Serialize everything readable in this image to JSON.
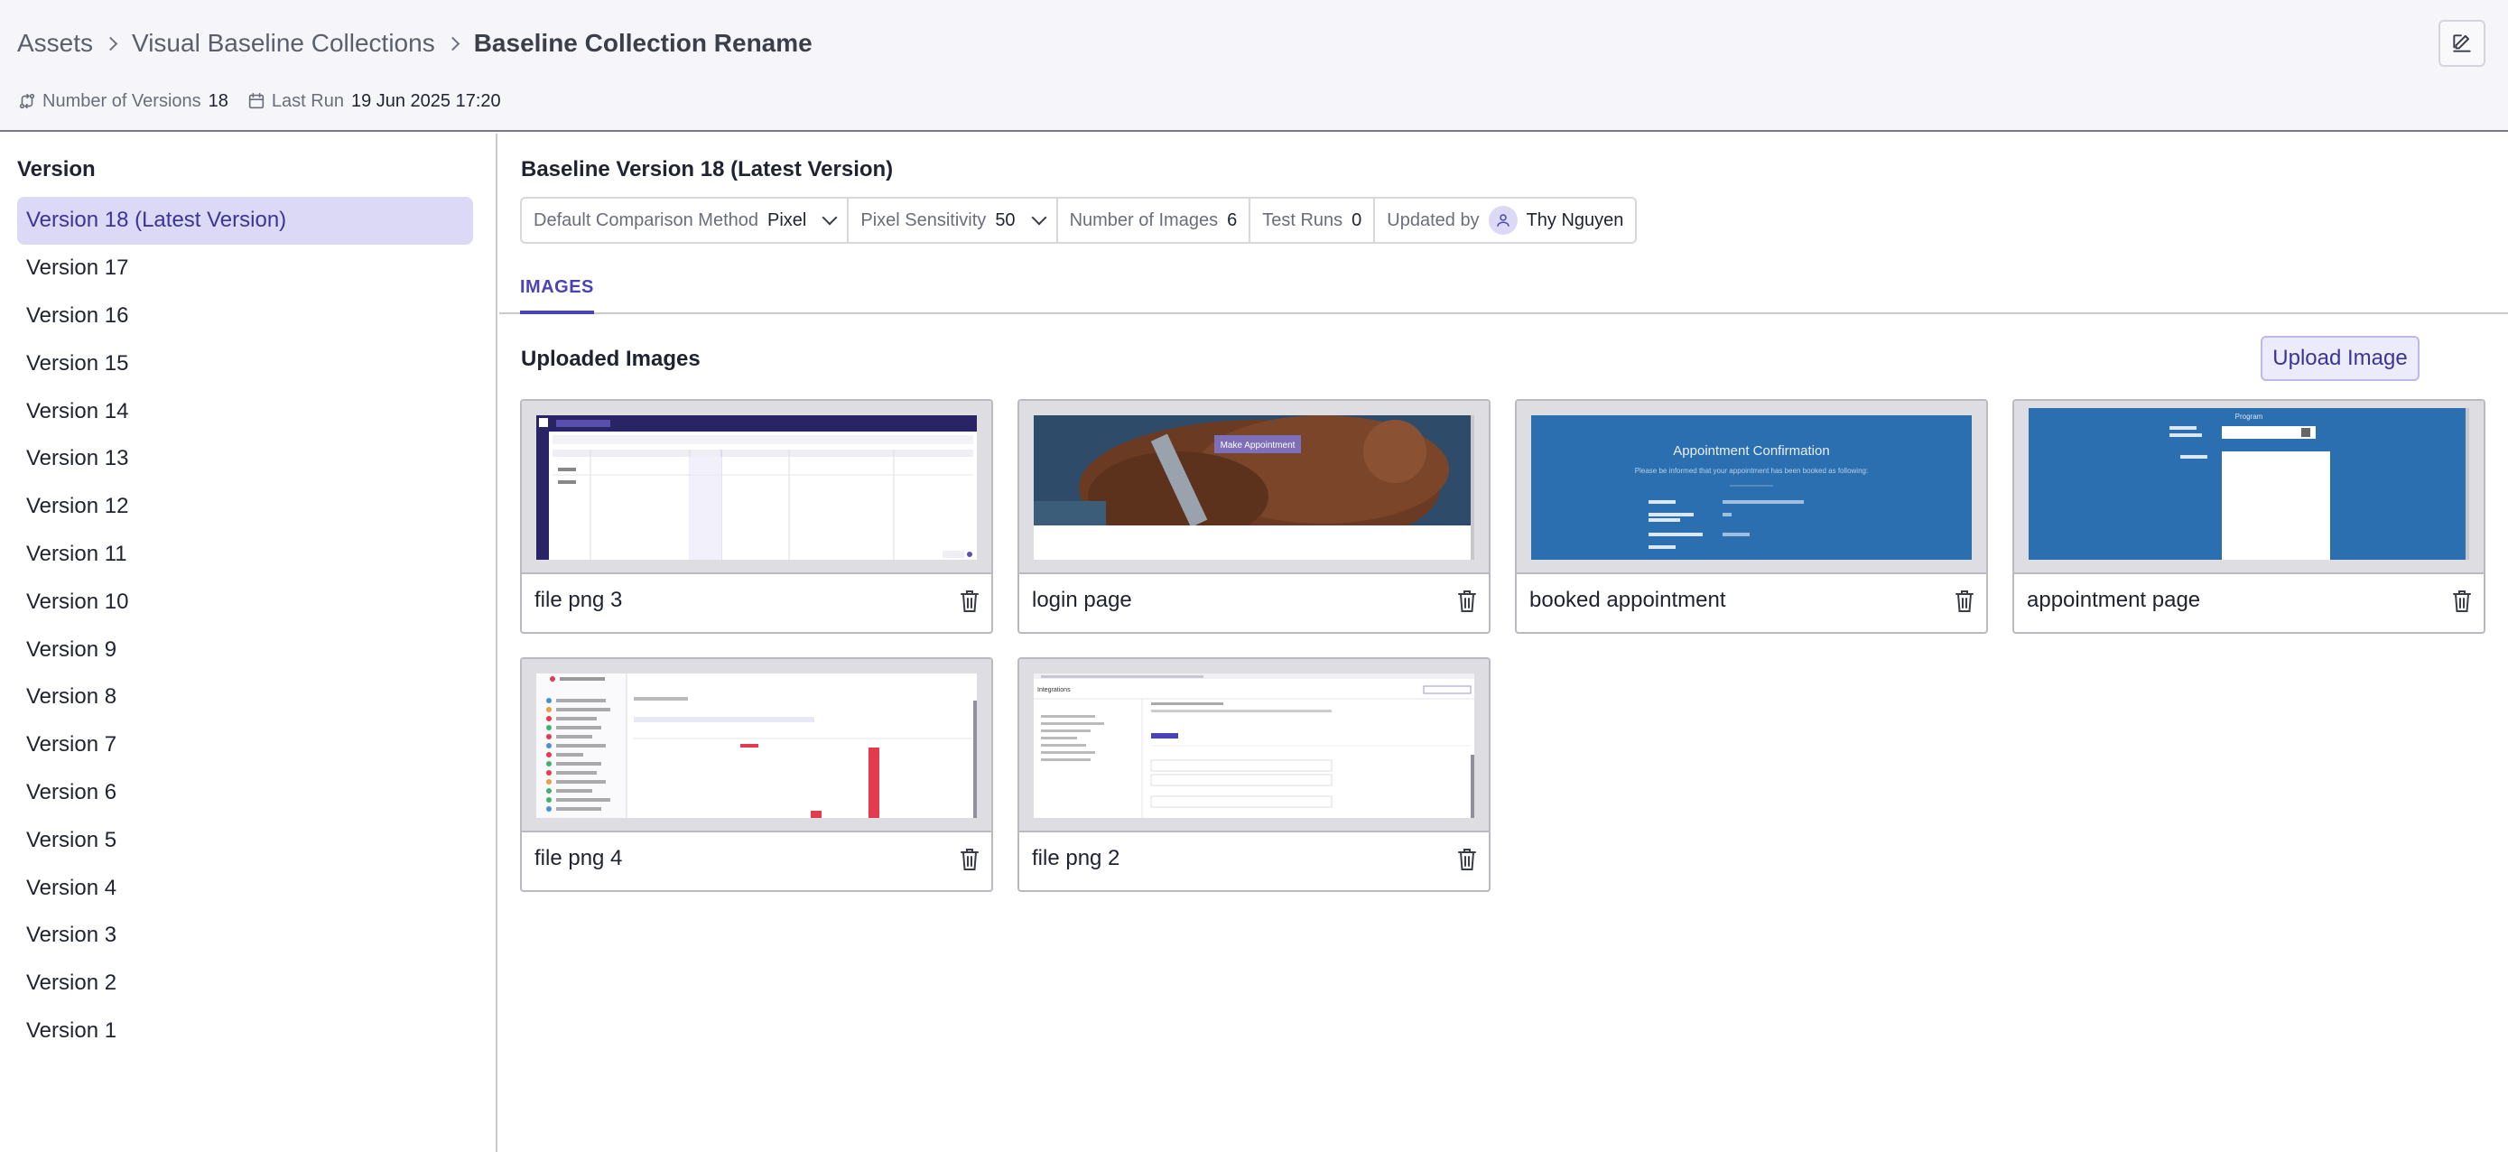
{
  "breadcrumb": {
    "items": [
      "Assets",
      "Visual Baseline Collections"
    ],
    "current": "Baseline Collection Rename"
  },
  "meta": {
    "versions_label": "Number of Versions",
    "versions_value": "18",
    "last_run_label": "Last Run",
    "last_run_value": "19 Jun 2025 17:20"
  },
  "sidebar": {
    "title": "Version",
    "items": [
      "Version 18 (Latest Version)",
      "Version 17",
      "Version 16",
      "Version 15",
      "Version 14",
      "Version 13",
      "Version 12",
      "Version 11",
      "Version 10",
      "Version 9",
      "Version 8",
      "Version 7",
      "Version 6",
      "Version 5",
      "Version 4",
      "Version 3",
      "Version 2",
      "Version 1"
    ]
  },
  "main": {
    "title": "Baseline Version 18 (Latest Version)",
    "props": {
      "comparison_label": "Default Comparison Method",
      "comparison_value": "Pixel",
      "sensitivity_label": "Pixel Sensitivity",
      "sensitivity_value": "50",
      "images_label": "Number of Images",
      "images_value": "6",
      "runs_label": "Test Runs",
      "runs_value": "0",
      "updated_label": "Updated by",
      "updated_value": "Thy Nguyen"
    },
    "tab": "IMAGES",
    "uploaded_title": "Uploaded Images",
    "upload_button": "Upload Image",
    "images": [
      {
        "label": "file png 3",
        "thumb": "calendar-app"
      },
      {
        "label": "login page",
        "thumb": "teddy-bear-photo"
      },
      {
        "label": "booked appointment",
        "thumb": "appointment-confirmation"
      },
      {
        "label": "appointment page",
        "thumb": "appointment-form"
      },
      {
        "label": "file png 4",
        "thumb": "dashboard-chart"
      },
      {
        "label": "file png 2",
        "thumb": "integrations-settings"
      }
    ],
    "thumb_text": {
      "make_appointment": "Make Appointment",
      "confirmation_title": "Appointment Confirmation",
      "confirmation_sub": "Please be informed that your appointment has been booked as following:",
      "program": "Program",
      "integrations": "Integrations"
    }
  },
  "colors": {
    "accent": "#4a43b8",
    "active_bg": "#dcd9f6",
    "thumb_blue": "#2b6fb0"
  }
}
